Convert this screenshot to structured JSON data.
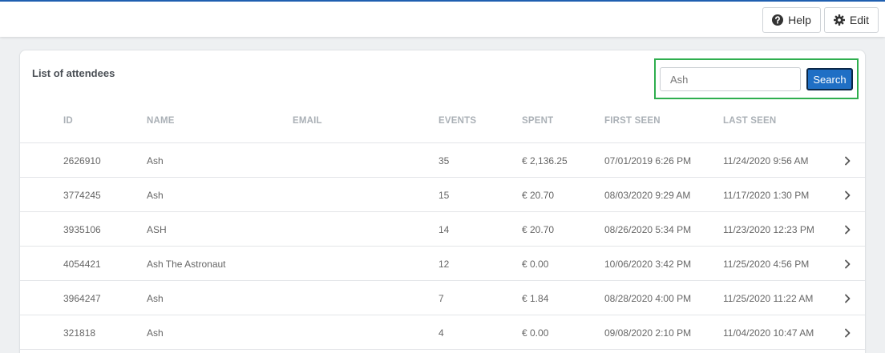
{
  "header": {
    "help_label": "Help",
    "edit_label": "Edit"
  },
  "card": {
    "title": "List of attendees"
  },
  "search": {
    "value": "Ash",
    "button_label": "Search"
  },
  "table": {
    "columns": {
      "id": "ID",
      "name": "NAME",
      "email": "EMAIL",
      "events": "EVENTS",
      "spent": "SPENT",
      "first_seen": "FIRST SEEN",
      "last_seen": "LAST SEEN"
    },
    "rows": [
      {
        "id": "2626910",
        "name": "Ash",
        "email": "",
        "events": "35",
        "spent": "€ 2,136.25",
        "first_seen": "07/01/2019 6:26 PM",
        "last_seen": "11/24/2020 9:56 AM"
      },
      {
        "id": "3774245",
        "name": "Ash",
        "email": "",
        "events": "15",
        "spent": "€ 20.70",
        "first_seen": "08/03/2020 9:29 AM",
        "last_seen": "11/17/2020 1:30 PM"
      },
      {
        "id": "3935106",
        "name": "ASH",
        "email": "",
        "events": "14",
        "spent": "€ 20.70",
        "first_seen": "08/26/2020 5:34 PM",
        "last_seen": "11/23/2020 12:23 PM"
      },
      {
        "id": "4054421",
        "name": "Ash The Astronaut",
        "email": "",
        "events": "12",
        "spent": "€ 0.00",
        "first_seen": "10/06/2020 3:42 PM",
        "last_seen": "11/25/2020 4:56 PM"
      },
      {
        "id": "3964247",
        "name": "Ash",
        "email": "",
        "events": "7",
        "spent": "€ 1.84",
        "first_seen": "08/28/2020 4:00 PM",
        "last_seen": "11/25/2020 11:22 AM"
      },
      {
        "id": "321818",
        "name": "Ash",
        "email": "",
        "events": "4",
        "spent": "€ 0.00",
        "first_seen": "09/08/2020 2:10 PM",
        "last_seen": "11/04/2020 10:47 AM"
      }
    ]
  },
  "colors": {
    "accent": "#1f6fc5",
    "highlight": "#2fae4e",
    "top_border": "#1f5fb0"
  },
  "icons": {
    "help": "question-circle-icon",
    "edit": "gear-icon",
    "row_action": "chevron-right-icon"
  }
}
